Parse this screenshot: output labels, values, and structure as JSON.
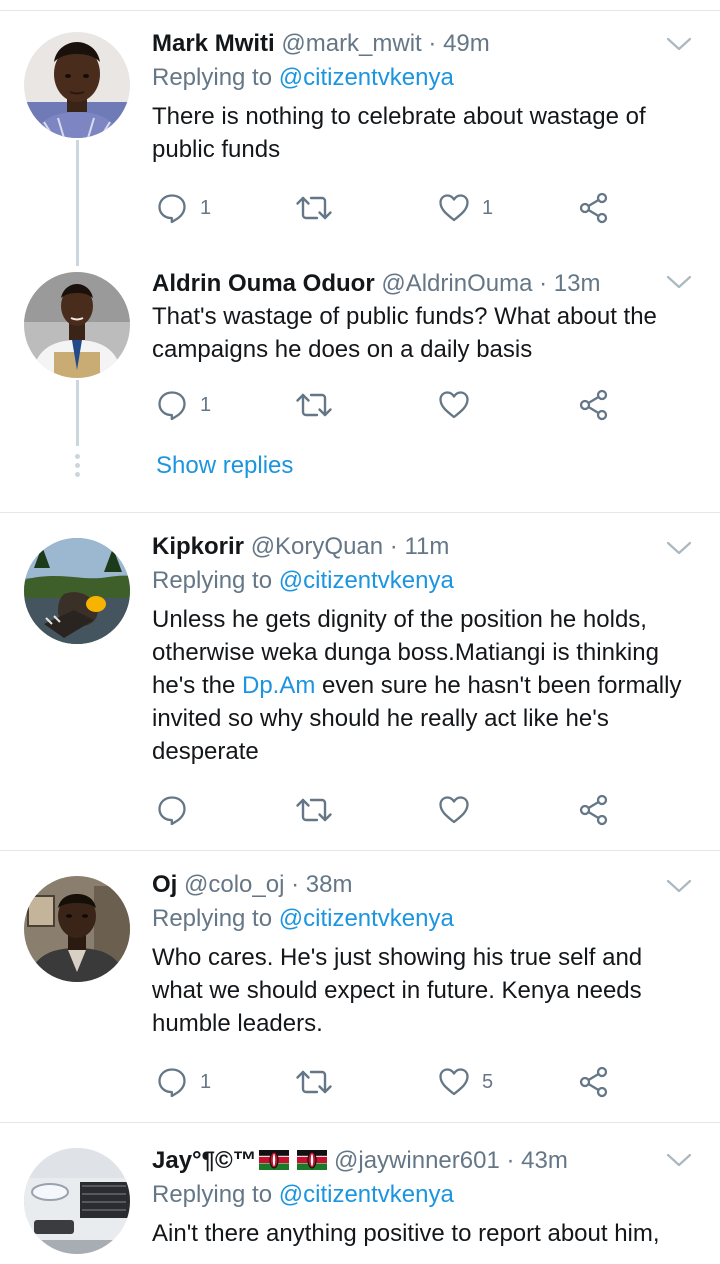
{
  "tweets": [
    {
      "name": "Mark Mwiti",
      "handle": "@mark_mwit",
      "sep": "·",
      "time": "49m",
      "reply_prefix": "Replying to ",
      "reply_to": "@citizentvkenya",
      "text": "There is nothing to celebrate about wastage of public funds",
      "reply_count": "1",
      "retweet_count": "",
      "like_count": "1"
    },
    {
      "name": "Aldrin Ouma Oduor",
      "handle": "@AldrinOuma",
      "sep": "·",
      "time": "13m",
      "text": "That's wastage of public funds? What about the campaigns he does on a daily basis",
      "reply_count": "1",
      "retweet_count": "",
      "like_count": "",
      "show_replies": "Show replies"
    },
    {
      "name": "Kipkorir",
      "handle": "@KoryQuan",
      "sep": "·",
      "time": "11m",
      "reply_prefix": "Replying to ",
      "reply_to": "@citizentvkenya",
      "text_before": "Unless he gets dignity of the position he holds, otherwise weka dunga boss.Matiangi is thinking he's the ",
      "text_link": "Dp.Am",
      "text_after": " even sure he hasn't been formally invited so why should he really act like  he's desperate",
      "reply_count": "",
      "retweet_count": "",
      "like_count": ""
    },
    {
      "name": "Oj",
      "handle": "@colo_oj",
      "sep": "·",
      "time": "38m",
      "reply_prefix": "Replying to ",
      "reply_to": "@citizentvkenya",
      "text": "Who cares. He's just showing his true self and what we should expect in future. Kenya needs humble leaders.",
      "reply_count": "1",
      "retweet_count": "",
      "like_count": "5"
    },
    {
      "name": "Jay°¶©™",
      "handle": "@jaywinner601",
      "sep": "·",
      "time": "43m",
      "reply_prefix": "Replying to ",
      "reply_to": "@citizentvkenya",
      "text": "Ain't there anything positive to report about him,"
    }
  ],
  "colors": {
    "link": "#1b95e0",
    "muted": "#657786",
    "text": "#14171a",
    "divider": "#e1e8ed",
    "thread": "#ccd6dd",
    "icon": "#657786"
  },
  "icons": {
    "reply": "reply-bubble-icon",
    "retweet": "retweet-arrows-icon",
    "like": "heart-icon",
    "share": "share-nodes-icon",
    "caret": "chevron-down-icon",
    "flag": "kenya-flag-emoji"
  }
}
